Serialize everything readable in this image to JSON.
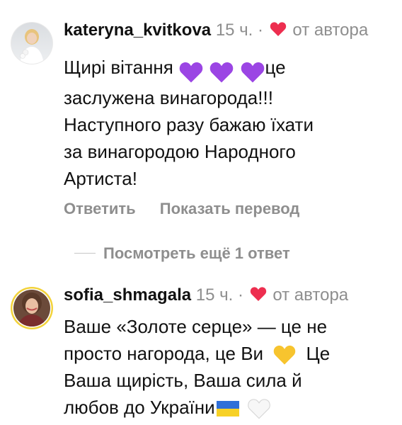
{
  "comments": [
    {
      "username": "kateryna_kvitkova",
      "time": "15 ч.",
      "dot": "·",
      "author_note": "от автора",
      "text_intro": "Щирі вітання",
      "text_after_emoji": "це",
      "text_line2": "заслужена винагорода!!!",
      "text_line3": "Наступного разу бажаю їхати",
      "text_line4": "за винагородою Народного",
      "text_line5": "Артиста!",
      "emojis": [
        "purple-heart",
        "purple-heart",
        "purple-heart"
      ],
      "reply_label": "Ответить",
      "translate_label": "Показать перевод"
    },
    {
      "username": "sofia_shmagala",
      "time": "15 ч.",
      "dot": "·",
      "author_note": "от автора",
      "text_line1": "Ваше «Золоте серце» — це не",
      "text_line2a": "просто нагорода, це Ви",
      "text_line2b": "Це",
      "text_line3": "Ваша щирість, Ваша сила й",
      "text_line4": "любов до України",
      "emojis": [
        "yellow-heart",
        "ukraine-flag",
        "white-heart"
      ]
    }
  ],
  "view_replies_label": "Посмотреть ещё 1 ответ",
  "colors": {
    "purple_heart": "#9b45e4",
    "red_heart": "#ed2e4f",
    "yellow_heart": "#f7c42e",
    "muted_text": "#8e8e8e"
  }
}
